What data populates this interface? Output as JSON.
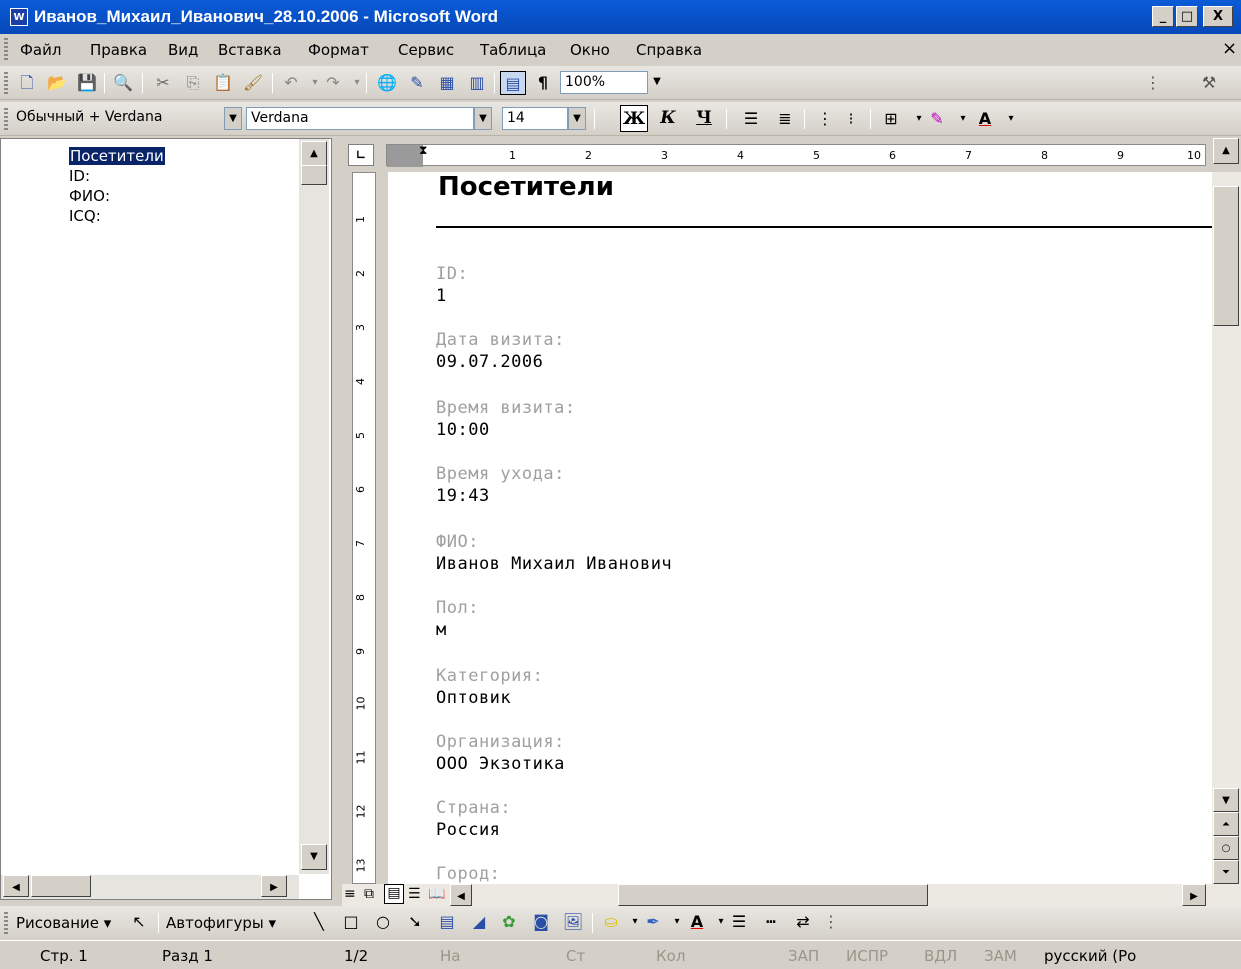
{
  "window": {
    "title": "Иванов_Михаил_Иванович_28.10.2006 - Microsoft Word",
    "app_icon": "W",
    "minimize": "_",
    "maximize": "□",
    "close": "X"
  },
  "menu": [
    "Файл",
    "Правка",
    "Вид",
    "Вставка",
    "Формат",
    "Сервис",
    "Таблица",
    "Окно",
    "Справка"
  ],
  "menu_close": "×",
  "standard_toolbar": {
    "zoom": "100%",
    "pilcrow": "¶"
  },
  "formatting_toolbar": {
    "style": "Обычный + Verdana",
    "font": "Verdana",
    "size": "14",
    "bold": "Ж",
    "italic": "К",
    "underline": "Ч"
  },
  "document_map": {
    "items": [
      "Посетители",
      "ID:",
      "ФИО:",
      "ICQ:"
    ]
  },
  "ruler": {
    "numbers": [
      "1",
      "2",
      "3",
      "4",
      "5",
      "6",
      "7",
      "8",
      "9",
      "10"
    ],
    "vnumbers": [
      "1",
      "2",
      "3",
      "4",
      "5",
      "6",
      "7",
      "8",
      "9",
      "10",
      "11",
      "12",
      "13"
    ]
  },
  "document": {
    "heading": "Посетители",
    "fields": [
      {
        "label": "ID:",
        "value": "1"
      },
      {
        "label": "Дата визита:",
        "value": "09.07.2006"
      },
      {
        "label": "Время визита:",
        "value": "10:00"
      },
      {
        "label": "Время ухода:",
        "value": "19:43"
      },
      {
        "label": "ФИО:",
        "value": "Иванов Михаил Иванович"
      },
      {
        "label": "Пол:",
        "value": "м"
      },
      {
        "label": "Категория:",
        "value": "Оптовик"
      },
      {
        "label": "Организация:",
        "value": "ООО Экзотика"
      },
      {
        "label": "Страна:",
        "value": "Россия"
      },
      {
        "label": "Город:",
        "value": ""
      }
    ]
  },
  "drawing_toolbar": {
    "drawing": "Рисование ▾",
    "autoshapes": "Автофигуры ▾"
  },
  "status": {
    "page": "Стр. 1",
    "section": "Разд 1",
    "pages": "1/2",
    "at": "На",
    "line": "Ст",
    "col": "Кол",
    "rec": "ЗАП",
    "trk": "ИСПР",
    "ext": "ВДЛ",
    "ovr": "ЗАМ",
    "lang": "русский (Ро"
  }
}
